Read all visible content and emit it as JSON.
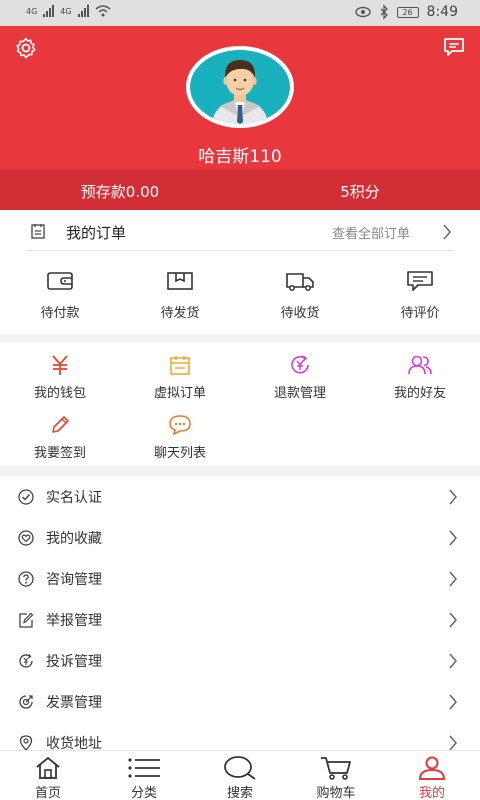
{
  "status_bar": {
    "time": "8:49",
    "battery": "26",
    "network_1": "4G",
    "network_2": "4G"
  },
  "header": {
    "username": "哈吉斯110",
    "balance_label": "预存款0.00",
    "points_label": "5积分"
  },
  "orders": {
    "title": "我的订单",
    "view_all": "查看全部订单",
    "items": [
      {
        "label": "待付款",
        "icon": "wallet-icon"
      },
      {
        "label": "待发货",
        "icon": "package-icon"
      },
      {
        "label": "待收货",
        "icon": "truck-icon"
      },
      {
        "label": "待评价",
        "icon": "comment-icon"
      }
    ]
  },
  "tools": [
    {
      "label": "我的钱包",
      "icon": "yuan-icon",
      "color": "#e8452f"
    },
    {
      "label": "虚拟订单",
      "icon": "calendar-icon",
      "color": "#f0a92d"
    },
    {
      "label": "退款管理",
      "icon": "refund-icon",
      "color": "#d63bd6"
    },
    {
      "label": "我的好友",
      "icon": "friends-icon",
      "color": "#d63bd6"
    },
    {
      "label": "我要签到",
      "icon": "pencil-icon",
      "color": "#e8452f"
    },
    {
      "label": "聊天列表",
      "icon": "chat-bubble-icon",
      "color": "#f07a2d"
    }
  ],
  "menu": [
    {
      "label": "实名认证",
      "icon": "check-circle-icon"
    },
    {
      "label": "我的收藏",
      "icon": "heart-circle-icon"
    },
    {
      "label": "咨询管理",
      "icon": "question-circle-icon"
    },
    {
      "label": "举报管理",
      "icon": "edit-icon"
    },
    {
      "label": "投诉管理",
      "icon": "yuan-circle-icon"
    },
    {
      "label": "发票管理",
      "icon": "invoice-icon"
    },
    {
      "label": "收货地址",
      "icon": "location-icon"
    }
  ],
  "tabbar": [
    {
      "label": "首页",
      "icon": "home-icon"
    },
    {
      "label": "分类",
      "icon": "list-icon"
    },
    {
      "label": "搜索",
      "icon": "search-icon"
    },
    {
      "label": "购物车",
      "icon": "cart-icon"
    },
    {
      "label": "我的",
      "icon": "user-icon",
      "active": true
    }
  ],
  "colors": {
    "accent": "#e8383d",
    "accent_dark": "#d12f35",
    "avatar_bg": "#19b1be"
  }
}
